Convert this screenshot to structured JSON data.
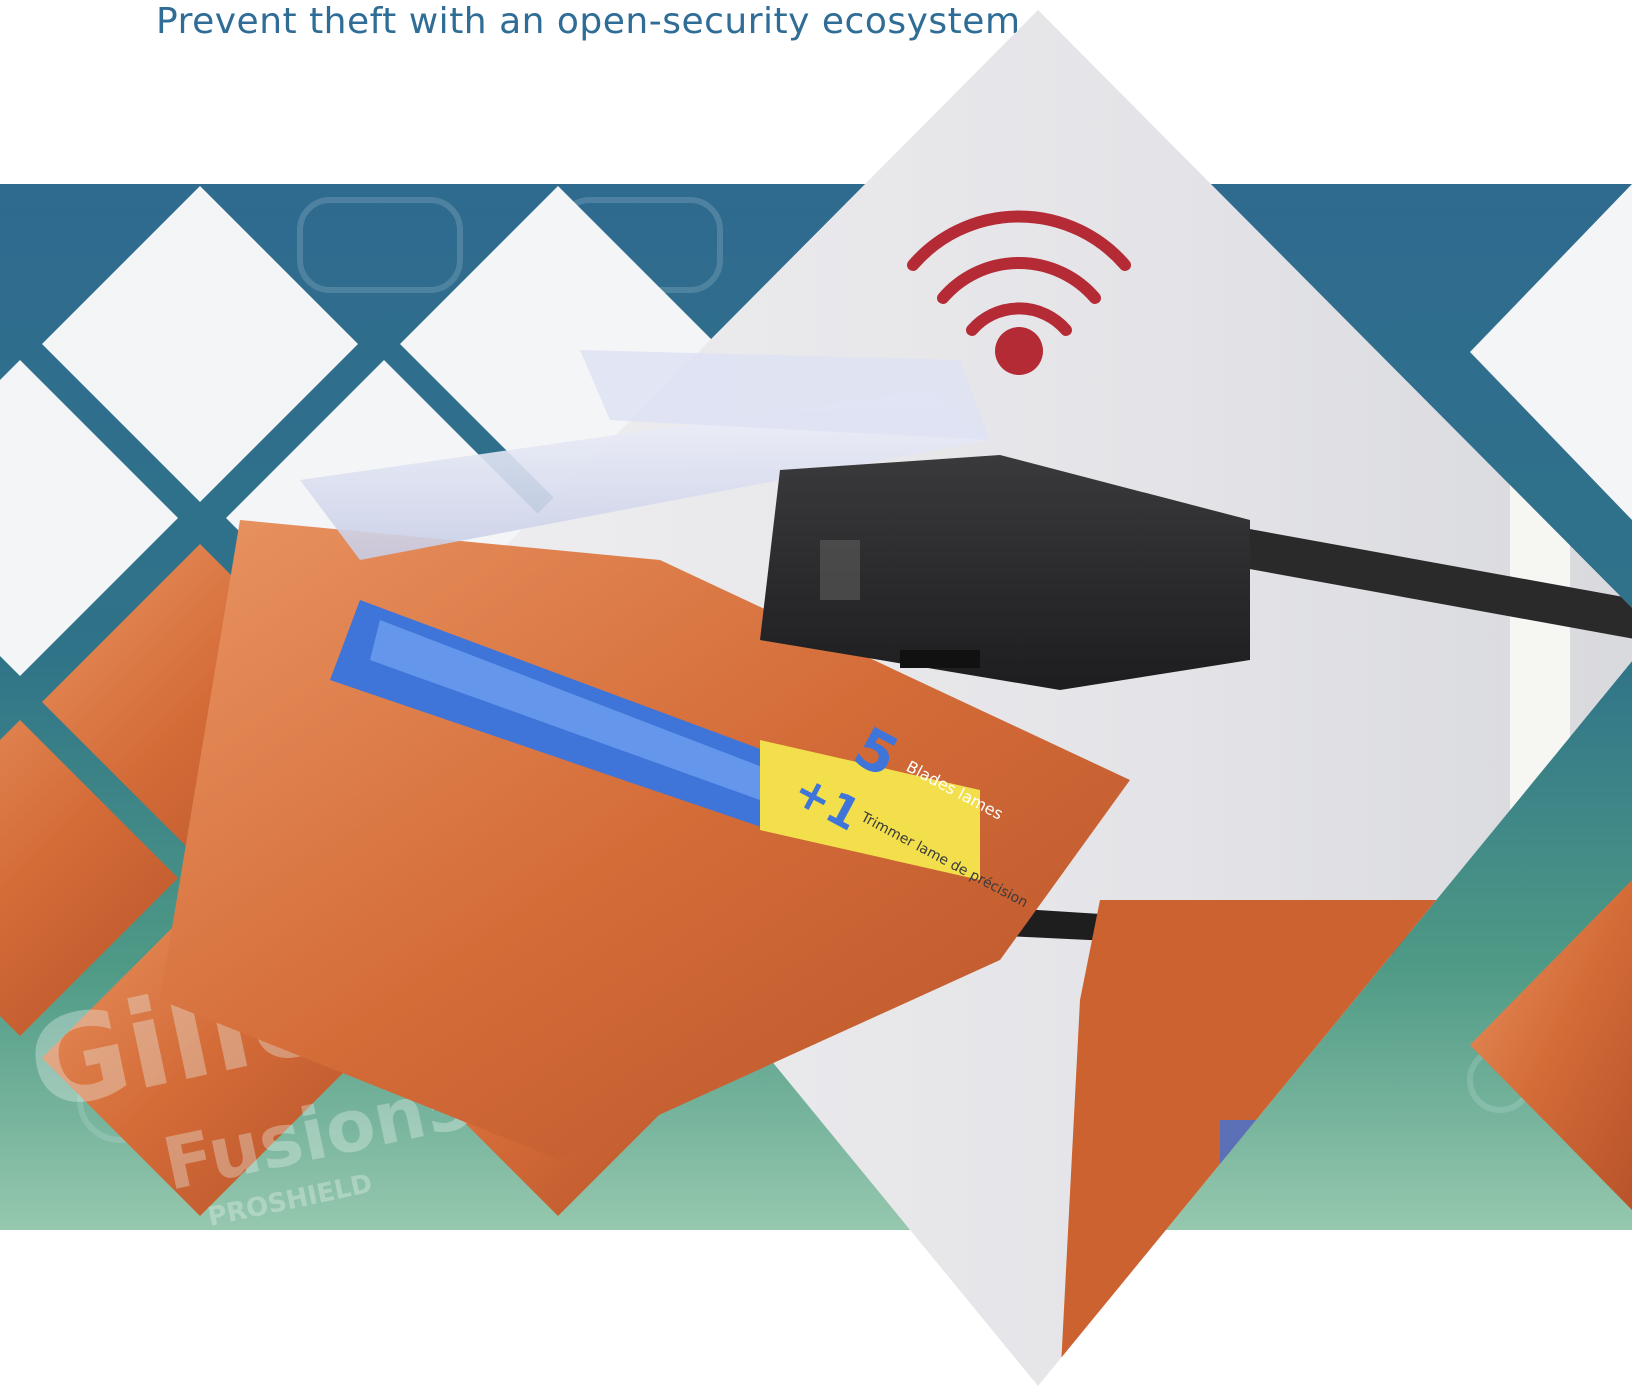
{
  "header": {
    "subtitle": "Prevent theft with an open-security ecosystem"
  },
  "colors": {
    "heading_text": "#2f6d97",
    "band_top": "#2f6a8f",
    "band_bottom": "#93c7ad",
    "signal_icon": "#b42b35",
    "security_tag": "#2b2b2b",
    "package_orange": "#cf6a3a",
    "cartridge_blue": "#3f74d8",
    "label_yellow": "#f2df4b"
  },
  "hero_image": {
    "subject": "security clip locked onto a razor-cartridge blister pack on a peg hook",
    "icons": [
      "wireless-signal-icon"
    ],
    "package_print": {
      "count_badge": "5",
      "count_text": "Blades lames",
      "bonus_badge": "+1",
      "bonus_text": "Trimmer lame de précision",
      "brand": "Gillette",
      "product": "Fusion5",
      "line": "PROSHIELD"
    }
  }
}
